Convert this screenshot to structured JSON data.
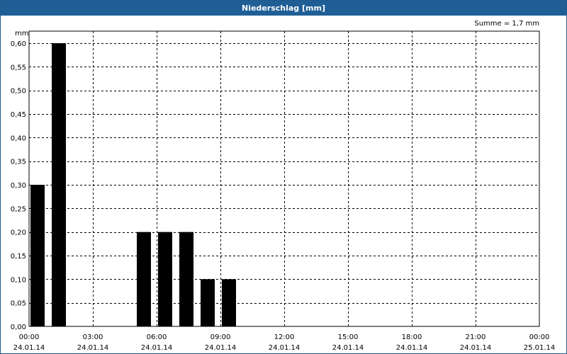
{
  "window": {
    "title": "Niederschlag [mm]"
  },
  "chart_data": {
    "type": "bar",
    "unit": "mm",
    "sum_label": "Summe = 1,7 mm",
    "colors": {
      "bars": "#000000",
      "title_bar": "#1f5f96",
      "grid": "#000000"
    },
    "grid": true,
    "ylim": [
      0,
      0.6
    ],
    "y_ticks": [
      "0,00",
      "0,05",
      "0,10",
      "0,15",
      "0,20",
      "0,25",
      "0,30",
      "0,35",
      "0,40",
      "0,45",
      "0,50",
      "0,55",
      "0,60"
    ],
    "x_ticks": [
      {
        "time": "00:00",
        "date": "24.01.14"
      },
      {
        "time": "03:00",
        "date": "24.01.14"
      },
      {
        "time": "06:00",
        "date": "24.01.14"
      },
      {
        "time": "09:00",
        "date": "24.01.14"
      },
      {
        "time": "12:00",
        "date": "24.01.14"
      },
      {
        "time": "15:00",
        "date": "24.01.14"
      },
      {
        "time": "18:00",
        "date": "24.01.14"
      },
      {
        "time": "21:00",
        "date": "24.01.14"
      },
      {
        "time": "00:00",
        "date": "25.01.14"
      }
    ],
    "x_range_hours": [
      0,
      24
    ],
    "bars": [
      {
        "start": "00:00",
        "end": "01:00",
        "value": 0.3
      },
      {
        "start": "01:00",
        "end": "02:00",
        "value": 0.6
      },
      {
        "start": "05:00",
        "end": "06:00",
        "value": 0.2
      },
      {
        "start": "06:00",
        "end": "07:00",
        "value": 0.2
      },
      {
        "start": "07:00",
        "end": "08:00",
        "value": 0.2
      },
      {
        "start": "08:00",
        "end": "09:00",
        "value": 0.1
      },
      {
        "start": "09:00",
        "end": "10:00",
        "value": 0.1
      }
    ]
  }
}
